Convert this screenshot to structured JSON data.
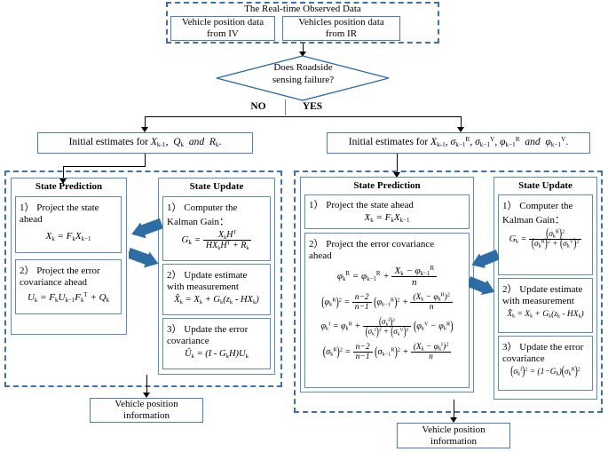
{
  "diagram": {
    "title": "Real-time observed data Kalman filter / data-fusion flowchart",
    "colors": {
      "box_border": "#4a7ebb",
      "dashed_border": "#3e6fae",
      "fat_arrow": "#2e6da4",
      "line": "#000000",
      "divider": "#808080"
    }
  },
  "top": {
    "group_label": "The Real-time Observed Data",
    "source_left": "Vehicle position data from IV",
    "source_left_l1": "Vehicle position data",
    "source_left_l2": "from IV",
    "source_right": "Vehicles position data from IR",
    "source_right_l1": "Vehicles position data",
    "source_right_l2": "from IR"
  },
  "decision": {
    "line1": "Does Roadside",
    "line2": "sensing failure?",
    "branch_no": "NO",
    "branch_yes": "YES"
  },
  "init": {
    "left_prefix": "Initial estimates for",
    "left_vars": "X(k-1), Q(k) and R(k).",
    "right_prefix": "Initial estimates for",
    "right_vars": "X(k-1), sigma^R(k-1), sigma^V(k-1), phi^R(k-1) and phi^V(k-1)."
  },
  "left_branch": {
    "prediction_header": "State Prediction",
    "update_header": "State Update",
    "prediction_steps": [
      {
        "num": "1）",
        "text_l1": "Project the state",
        "text_l2": "ahead",
        "equation": "X_k = F_k X_{k-1}"
      },
      {
        "num": "2）",
        "text_l1": "Project the error",
        "text_l2": "covariance ahead",
        "equation": "U_k = F_k U_{k-1} F_k^T + Q_k"
      }
    ],
    "update_steps": [
      {
        "num": "1）",
        "text_l1": "Computer the",
        "text_l2": "Kalman Gain：",
        "equation": "G_k = X_k H^T / (H X_k H^T + R_k)"
      },
      {
        "num": "2）",
        "text_l1": "Update estimate",
        "text_l2": "with measurement",
        "equation": "X̂_k = X_k + G_k ( z_k - H X_k )"
      },
      {
        "num": "3）",
        "text_l1": "Update the error",
        "text_l2": "covariance",
        "equation": "Û_k = ( I - G_k H ) U_k"
      }
    ],
    "output": {
      "l1": "Vehicle position",
      "l2": "information"
    }
  },
  "right_branch": {
    "prediction_header": "State Prediction",
    "update_header": "State Update",
    "prediction_steps": [
      {
        "num": "1）",
        "text_l1": "Project the state ahead",
        "text_l2": "",
        "equation": "X_k = F_k X_{k-1}"
      },
      {
        "num": "2）",
        "text_l1": "Project the error covariance",
        "text_l2": "ahead",
        "equations": [
          "phi^R_k = phi^R_{k-1} + (X_k - phi^R_{k-1}) / n",
          "(phi^R_k)^2 = (n-2)/(n-1) (phi^R_{k-1})^2 + (X_k - phi^R_k)^2 / n",
          "phi^I_k = phi^R_k + (sigma^I_k)^2 / ((sigma^I_k)^2 + (sigma^V_k)^2) ( phi^V_k - phi^R_k )",
          "(sigma^R_k)^2 = (n-2)/(n-1) (sigma^R_{k-1})^2 + (X_k - phi^I_k)^2 / n"
        ]
      }
    ],
    "update_steps": [
      {
        "num": "1）",
        "text_l1": "Computer the",
        "text_l2": "Kalman Gain：",
        "equation": "G_k = (sigma^R_k)^2 / ((sigma^R_k)^2 + (sigma^V_k)^2)"
      },
      {
        "num": "2）",
        "text_l1": "Update estimate",
        "text_l2": "with measurement",
        "equation": "X̂_k = X_k + G_k ( z_k - H X_k )"
      },
      {
        "num": "3）",
        "text_l1": "Update the error",
        "text_l2": "covariance",
        "equation": "(sigma^I_k)^2 = ( 1 - G_k )( sigma^R_k )^2"
      }
    ],
    "output": {
      "l1": "Vehicle position",
      "l2": "information"
    }
  }
}
